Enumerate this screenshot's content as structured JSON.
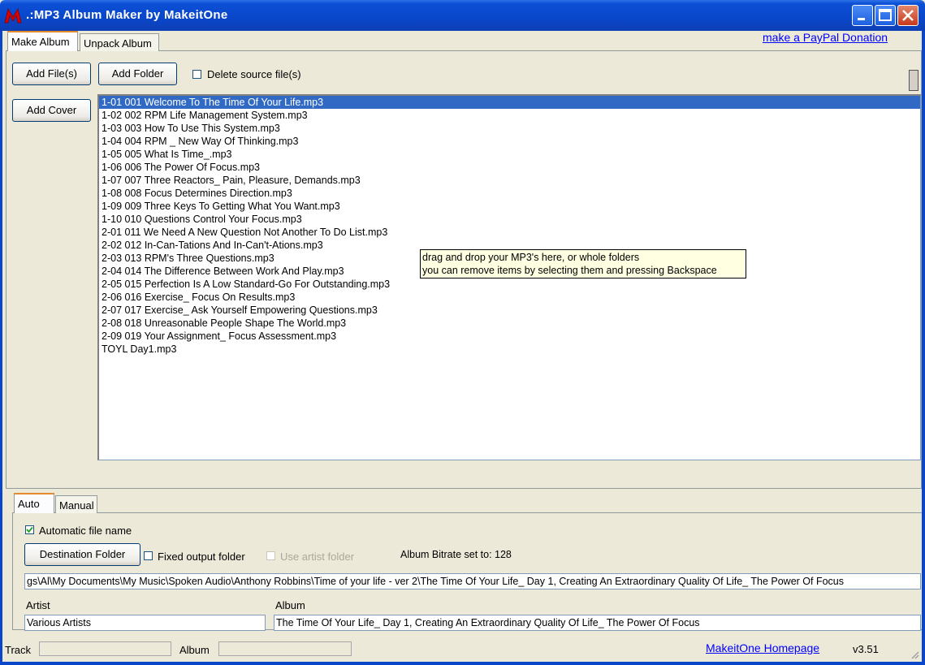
{
  "window": {
    "title": ".:MP3 Album Maker by MakeitOne",
    "minimize_icon": "minimize-icon",
    "maximize_icon": "maximize-icon",
    "close_icon": "close-icon"
  },
  "tabs": [
    {
      "label": "Make Album",
      "active": true
    },
    {
      "label": "Unpack Album",
      "active": false
    }
  ],
  "paypal_link": "make a PayPal Donation",
  "toolbar": {
    "add_files": "Add File(s)",
    "add_folder": "Add Folder",
    "delete_source": "Delete source file(s)",
    "delete_source_checked": false,
    "add_cover": "Add Cover"
  },
  "files": [
    "1-01 001 Welcome To The Time Of Your Life.mp3",
    "1-02 002 RPM Life Management System.mp3",
    "1-03 003 How To Use This System.mp3",
    "1-04 004 RPM _ New Way Of Thinking.mp3",
    "1-05 005 What Is Time_.mp3",
    "1-06 006 The Power Of Focus.mp3",
    "1-07 007 Three Reactors_ Pain, Pleasure, Demands.mp3",
    "1-08 008 Focus Determines Direction.mp3",
    "1-09 009 Three Keys To Getting What You Want.mp3",
    "1-10 010 Questions Control Your Focus.mp3",
    "2-01 011 We Need A New Question Not Another To Do List.mp3",
    "2-02 012 In-Can-Tations And In-Can't-Ations.mp3",
    "2-03 013 RPM's Three Questions.mp3",
    "2-04 014 The Difference Between Work And Play.mp3",
    "2-05 015 Perfection Is A Low Standard-Go For Outstanding.mp3",
    "2-06 016 Exercise_ Focus On Results.mp3",
    "2-07 017 Exercise_ Ask Yourself Empowering Questions.mp3",
    "2-08 018 Unreasonable People Shape The World.mp3",
    "2-09 019 Your Assignment_ Focus Assessment.mp3",
    "TOYL Day1.mp3"
  ],
  "selected_file_index": 0,
  "tooltip": {
    "line1": "drag and drop your MP3's here, or whole folders",
    "line2": "you can remove items by selecting them and pressing Backspace"
  },
  "subtabs": [
    {
      "label": "Auto",
      "active": true
    },
    {
      "label": "Manual",
      "active": false
    }
  ],
  "auto": {
    "automatic_file_name": "Automatic file name",
    "automatic_file_name_checked": true,
    "destination_folder": "Destination Folder",
    "fixed_output_folder": "Fixed output folder",
    "fixed_output_folder_checked": false,
    "use_artist_folder": "Use artist folder",
    "bitrate": "Album Bitrate set to: 128",
    "output_path": "gs\\Al\\My Documents\\My Music\\Spoken Audio\\Anthony Robbins\\Time of your life - ver 2\\The Time Of Your Life_ Day 1, Creating An Extraordinary Quality Of Life_ The Power Of Focus",
    "artist_label": "Artist",
    "artist_value": "Various Artists",
    "album_label": "Album",
    "album_value": "The Time Of Your Life_ Day 1, Creating An Extraordinary Quality Of Life_ The Power Of Focus"
  },
  "status": {
    "track_label": "Track",
    "track_value": "",
    "album_label": "Album",
    "album_value": "",
    "homepage_link": "MakeitOne Homepage",
    "version": "v3.51"
  },
  "colors": {
    "titlebar": "#0A46C9",
    "selection": "#316AC5",
    "link": "#0000FF",
    "tooltip_bg": "#FFFFE1"
  }
}
